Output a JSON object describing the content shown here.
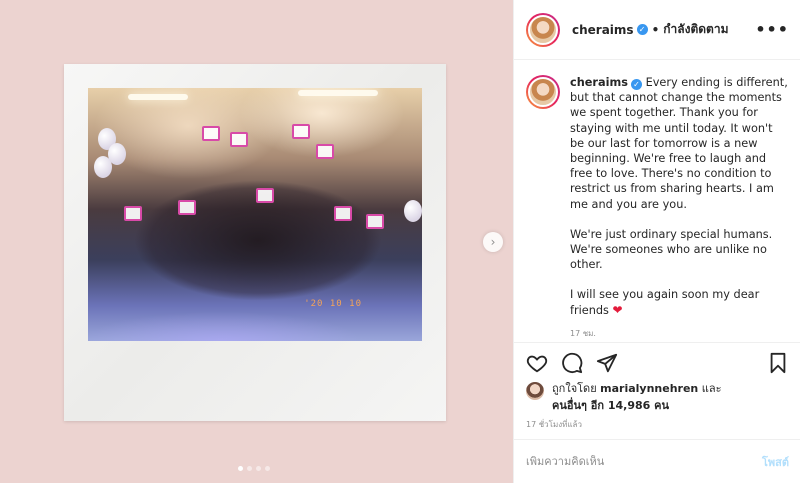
{
  "post": {
    "username": "cheraims",
    "follow_status": "กำลังติดตาม",
    "separator": "•",
    "more_icon": "•••",
    "next_arrow": "›",
    "photo_stamp": "'20 10 10",
    "caption_paragraphs": [
      "Every ending is different, but that cannot change the moments we spent together. Thank you for staying with me until today. It won't be our last for tomorrow is a new beginning. We're free to laugh and free to love. There's no condition to restrict us from sharing hearts. I am me and you are you.",
      "We're just ordinary special humans. We're someones who are unlike no other.",
      "I will see you again soon my dear friends"
    ],
    "caption_emoji": "❤",
    "caption_time": "17 ชม.",
    "liked_by_prefix": "ถูกใจโดย",
    "liked_by_user": "marialynnehren",
    "liked_by_and": "และ",
    "liked_by_others": "คนอื่นๆ อีก 14,986 คน",
    "post_time": "17 ชั่วโมงที่แล้ว",
    "comment_placeholder": "เพิ่มความคิดเห็น",
    "post_button": "โพสต์",
    "carousel_dots": 4,
    "active_dot": 0
  },
  "colors": {
    "background_pink": "#ecd3d0",
    "verified_blue": "#3897f0",
    "post_button_disabled": "#b2dffc",
    "heart_red": "#e31b3b"
  },
  "icons": [
    "heart-icon",
    "comment-icon",
    "share-icon",
    "bookmark-icon",
    "verified-icon",
    "more-icon",
    "chevron-right-icon"
  ]
}
